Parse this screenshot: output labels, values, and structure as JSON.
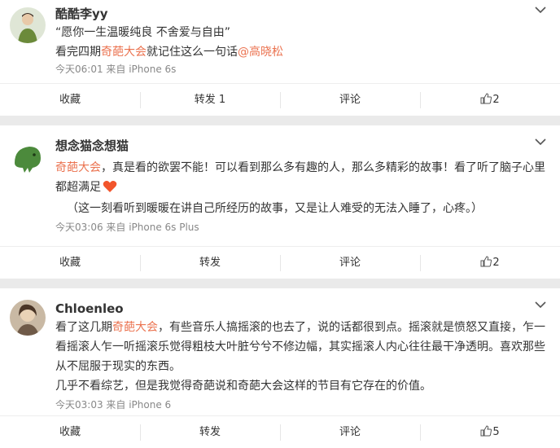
{
  "posts": [
    {
      "username": "酷酷李yy",
      "lines": [
        {
          "segments": [
            {
              "t": "“愿你一生温暖纯良 不舍爱与自由”",
              "c": ""
            }
          ]
        },
        {
          "segments": [
            {
              "t": "看完四期",
              "c": ""
            },
            {
              "t": "奇葩大会",
              "c": "hl"
            },
            {
              "t": "就记住这么一句话",
              "c": ""
            },
            {
              "t": "@高晓松",
              "c": "mention"
            }
          ]
        }
      ],
      "meta": "今天06:01 来自 iPhone 6s",
      "actions": {
        "collect": "收藏",
        "repost": "转发 1",
        "comment": "评论",
        "like_count": "2"
      }
    },
    {
      "username": "想念猫念想猫",
      "lines": [
        {
          "segments": [
            {
              "t": "奇葩大会",
              "c": "hl"
            },
            {
              "t": "，真是看的欲罢不能！可以看到那么多有趣的人，那么多精彩的故事！看了听了脑子心里",
              "c": ""
            }
          ]
        },
        {
          "segments": [
            {
              "t": "都超满足",
              "c": ""
            }
          ],
          "heart": true
        },
        {
          "segments": [
            {
              "t": "（这一刻看听到暖暖在讲自己所经历的故事，又是让人难受的无法入睡了，心疼。）",
              "c": ""
            }
          ],
          "indent": true
        }
      ],
      "meta": "今天03:06 来自 iPhone 6s Plus",
      "actions": {
        "collect": "收藏",
        "repost": "转发",
        "comment": "评论",
        "like_count": "2"
      }
    },
    {
      "username": "Chloenleo",
      "lines": [
        {
          "segments": [
            {
              "t": "看了这几期",
              "c": ""
            },
            {
              "t": "奇葩大会",
              "c": "hl"
            },
            {
              "t": "，有些音乐人搞摇滚的也去了，说的话都很到点。摇滚就是愤怒又直接，乍一",
              "c": ""
            }
          ]
        },
        {
          "segments": [
            {
              "t": "看摇滚人乍一听摇滚乐觉得粗枝大叶脏兮兮不修边幅，其实摇滚人内心往往最干净透明。喜欢那些",
              "c": ""
            }
          ]
        },
        {
          "segments": [
            {
              "t": "从不屈服于现实的东西。",
              "c": ""
            }
          ]
        },
        {
          "segments": [
            {
              "t": "几乎不看综艺，但是我觉得奇葩说和奇葩大会这样的节目有它存在的价值。",
              "c": ""
            }
          ]
        }
      ],
      "meta": "今天03:03 来自 iPhone 6",
      "actions": {
        "collect": "收藏",
        "repost": "转发",
        "comment": "评论",
        "like_count": "5"
      }
    }
  ],
  "icons": {
    "caret": "chevron-down-icon",
    "like": "thumbs-up-icon",
    "heart": "heart-emoji-icon"
  },
  "colors": {
    "highlight": "#eb7350",
    "text": "#333333",
    "meta": "#888888",
    "divider": "#eaeaea"
  }
}
